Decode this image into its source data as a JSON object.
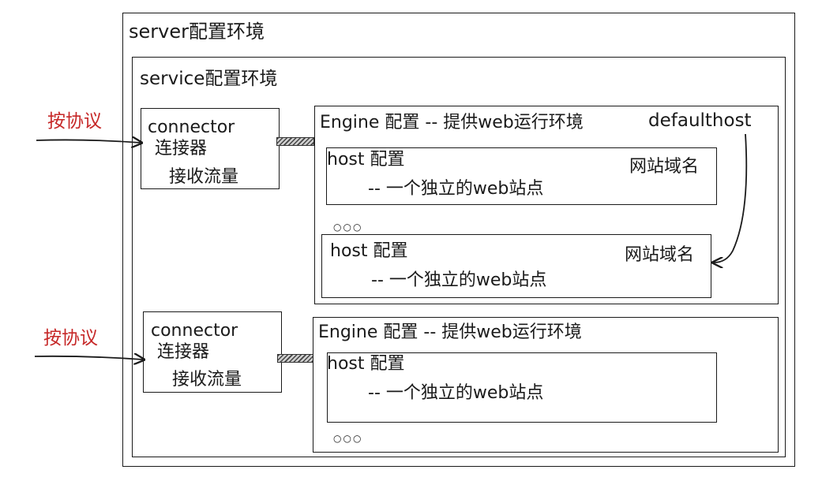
{
  "server": {
    "title": "server配置环境"
  },
  "service": {
    "title": "service配置环境"
  },
  "connector1": {
    "label_protocol": "按协议",
    "title": "connector",
    "subtitle": "连接器",
    "desc": "接收流量"
  },
  "connector2": {
    "label_protocol": "按协议",
    "title": "connector",
    "subtitle": "连接器",
    "desc": "接收流量"
  },
  "engine1": {
    "title": "Engine 配置 -- 提供web运行环境",
    "defaulthost": "defaulthost",
    "hosts": [
      {
        "title": "host 配置",
        "desc": "-- 一个独立的web站点",
        "domain": "网站域名"
      },
      {
        "title": "host 配置",
        "desc": "-- 一个独立的web站点",
        "domain": "网站域名"
      }
    ],
    "ellipsis": "○○○"
  },
  "engine2": {
    "title": "Engine 配置 -- 提供web运行环境",
    "hosts": [
      {
        "title": "host 配置",
        "desc": "-- 一个独立的web站点"
      }
    ],
    "ellipsis": "○○○"
  }
}
